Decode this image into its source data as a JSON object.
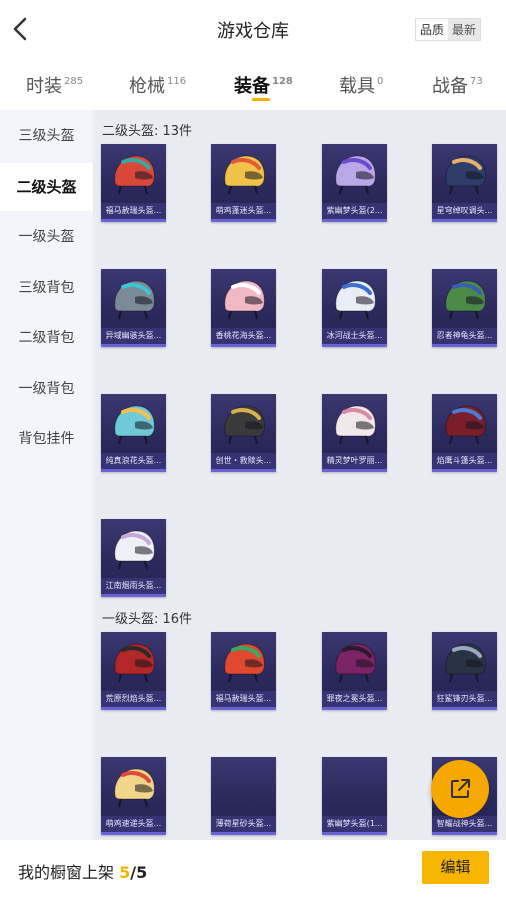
{
  "header": {
    "title": "游戏仓库",
    "sort_quality": "品质",
    "sort_newest": "最新"
  },
  "tabs": [
    {
      "label": "时装",
      "count": "285"
    },
    {
      "label": "枪械",
      "count": "116"
    },
    {
      "label": "装备",
      "count": "128"
    },
    {
      "label": "载具",
      "count": "0"
    },
    {
      "label": "战备",
      "count": "73"
    }
  ],
  "sidebar": {
    "items": [
      {
        "label": "三级头盔"
      },
      {
        "label": "二级头盔"
      },
      {
        "label": "一级头盔"
      },
      {
        "label": "三级背包"
      },
      {
        "label": "二级背包"
      },
      {
        "label": "一级背包"
      },
      {
        "label": "背包挂件"
      }
    ]
  },
  "sections": [
    {
      "title": "二级头盔: 13件",
      "items": [
        {
          "name": "福马赦瑞头盔...",
          "color": "#d9473b",
          "accent": "#3aa6a0"
        },
        {
          "name": "萌鸡蓬迷头盔...",
          "color": "#f0c24a",
          "accent": "#e05a3a"
        },
        {
          "name": "紫幽梦头盔(2...",
          "color": "#b9a7e8",
          "accent": "#6d4bd0"
        },
        {
          "name": "星穹绰叹调头...",
          "color": "#2e3e6a",
          "accent": "#e8b06a"
        },
        {
          "name": "异域幽骇头盔...",
          "color": "#7a8a96",
          "accent": "#3fc2d4"
        },
        {
          "name": "香桃花海头盔...",
          "color": "#f2b8c4",
          "accent": "#ffffff"
        },
        {
          "name": "冰河战士头盔...",
          "color": "#e9eef6",
          "accent": "#3a6fd8"
        },
        {
          "name": "忍者神龟头盔...",
          "color": "#4c8a4a",
          "accent": "#3a5fb0"
        },
        {
          "name": "纯真浪花头盔...",
          "color": "#6fc9d9",
          "accent": "#f4c14a"
        },
        {
          "name": "创世・救赎头...",
          "color": "#3a3a3a",
          "accent": "#d7b24a"
        },
        {
          "name": "精灵梦叶罗丽...",
          "color": "#f1e8ea",
          "accent": "#d98aa6"
        },
        {
          "name": "焰鹰斗篷头盔...",
          "color": "#7a1f2a",
          "accent": "#4a7ad8"
        },
        {
          "name": "江南烟雨头盔...",
          "color": "#eef0f6",
          "accent": "#c7a7d8"
        }
      ]
    },
    {
      "title": "一级头盔: 16件",
      "items": [
        {
          "name": "荒原烈焰头盔...",
          "color": "#b3262a",
          "accent": "#2a2a2a"
        },
        {
          "name": "福马赦瑞头盔...",
          "color": "#e0492f",
          "accent": "#3aa860"
        },
        {
          "name": "罪夜之冕头盔...",
          "color": "#7a2466",
          "accent": "#2a1a2a"
        },
        {
          "name": "狂鲨锋刃头盔...",
          "color": "#2a3344",
          "accent": "#9aa8c0"
        },
        {
          "name": "萌鸡速递头盔...",
          "color": "#f1d58a",
          "accent": "#e0483a"
        },
        {
          "name": "薄荷星砂头盔...",
          "color": "",
          "accent": ""
        },
        {
          "name": "紫幽梦头盔(1...",
          "color": "",
          "accent": ""
        },
        {
          "name": "智耀战神头盔...",
          "color": "#3a3a6a",
          "accent": "#cfa84a"
        }
      ]
    }
  ],
  "footer": {
    "label": "我的橱窗上架",
    "current": "5",
    "total": "/5",
    "edit_label": "编辑"
  },
  "colors": {
    "accent": "#f5b400",
    "card_bg": "#2c2a5c",
    "sidebar_bg": "#f2f5f9",
    "content_bg": "#e9edf2"
  },
  "icons": {
    "back": "chevron-left-icon",
    "share": "share-external-icon"
  }
}
